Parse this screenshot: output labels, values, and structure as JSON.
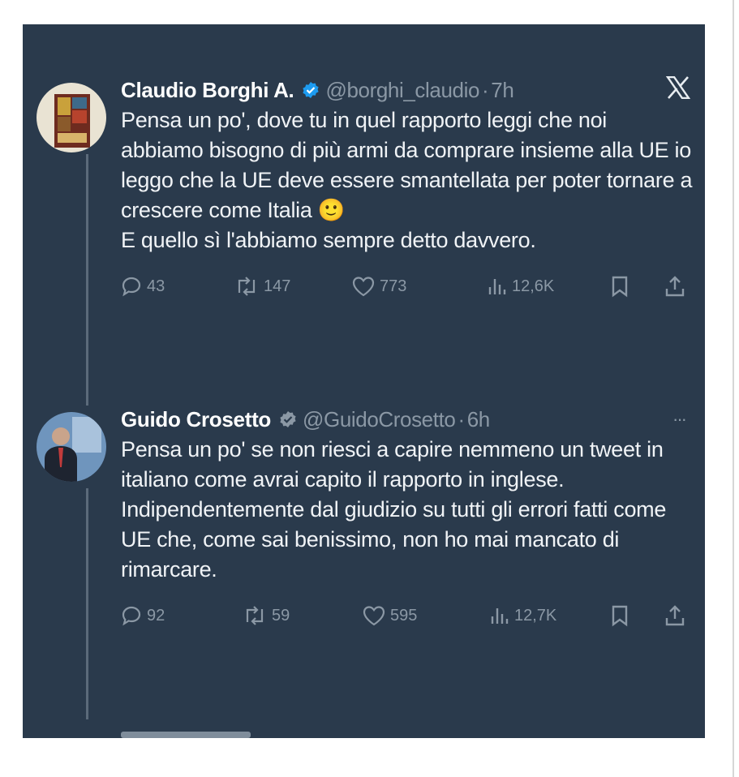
{
  "tweets": [
    {
      "name": "Claudio Borghi A.",
      "handle": "@borghi_claudio",
      "time": "7h",
      "verified_color": "#1d9bf0",
      "header_right": "x-logo-icon",
      "body": "Pensa un po', dove tu in quel rapporto leggi che noi abbiamo bisogno di più armi da comprare insieme alla UE io leggo che la UE deve essere smantellata per poter tornare a crescere come Italia 🙂\nE quello sì l'abbiamo sempre detto davvero.",
      "replies": "43",
      "reposts": "147",
      "likes": "773",
      "views": "12,6K"
    },
    {
      "name": "Guido Crosetto",
      "handle": "@GuidoCrosetto",
      "time": "6h",
      "verified_color": "#8b98a5",
      "header_right": "more-icon",
      "body": "Pensa un po' se non riesci a capire nemmeno un tweet in italiano come avrai capito il rapporto in inglese.\nIndipendentemente dal giudizio su tutti gli errori fatti come UE che, come sai benissimo, non ho mai mancato di rimarcare.",
      "replies": "92",
      "reposts": "59",
      "likes": "595",
      "views": "12,7K"
    }
  ],
  "separator": "·",
  "more_glyph": "···",
  "colors": {
    "background": "#2a3a4c",
    "text": "#f0f3f6",
    "muted": "#8b98a5"
  }
}
